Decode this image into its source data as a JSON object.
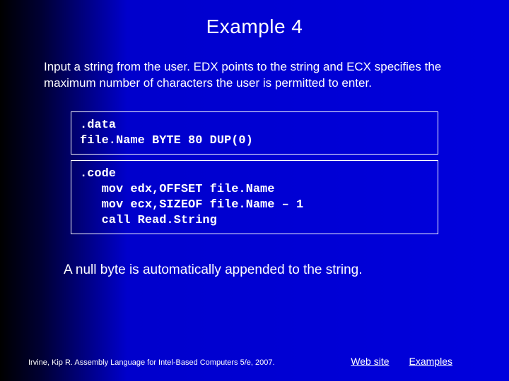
{
  "title": "Example 4",
  "paragraph1": "Input a string from the user. EDX points to the string and ECX specifies the maximum number of characters the user is permitted to enter.",
  "code_box1": ".data\nfile.Name BYTE 80 DUP(0)",
  "code_box2": ".code\n   mov edx,OFFSET file.Name\n   mov ecx,SIZEOF file.Name – 1\n   call Read.String",
  "paragraph2": "A null byte is automatically appended to the string.",
  "footer_citation": "Irvine, Kip R. Assembly Language for Intel-Based Computers 5/e, 2007.",
  "footer_links": {
    "website": "Web site",
    "examples": "Examples"
  }
}
